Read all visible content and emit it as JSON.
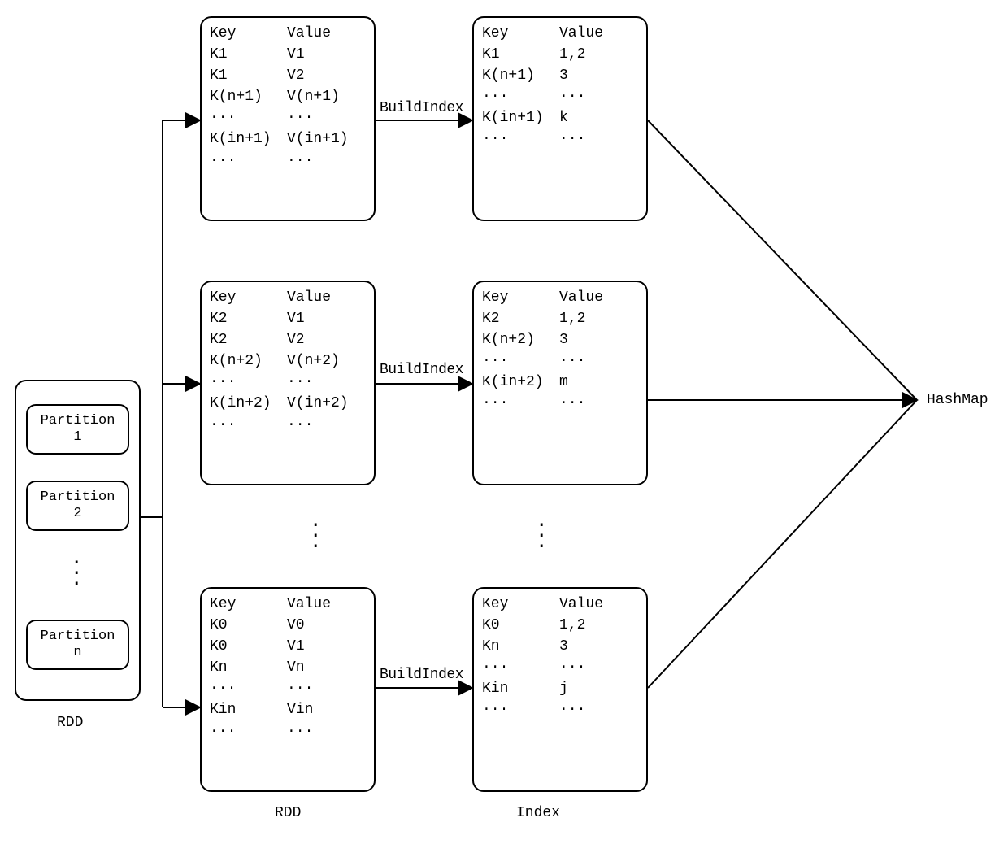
{
  "rdd": {
    "label": "RDD",
    "partitions": [
      {
        "line1": "Partition",
        "line2": "1"
      },
      {
        "line1": "Partition",
        "line2": "2"
      },
      {
        "line1": "Partition",
        "line2": "n"
      }
    ]
  },
  "kv_tables": [
    {
      "header": {
        "k": "Key",
        "v": "Value"
      },
      "rows": [
        {
          "k": "K1",
          "v": "V1"
        },
        {
          "k": "K1",
          "v": "V2"
        },
        {
          "k": "K(n+1)",
          "v": "V(n+1)"
        },
        {
          "k": "···",
          "v": "···"
        },
        {
          "k": "K(in+1)",
          "v": "V(in+1)"
        },
        {
          "k": "···",
          "v": "···"
        }
      ]
    },
    {
      "header": {
        "k": "Key",
        "v": "Value"
      },
      "rows": [
        {
          "k": "K2",
          "v": "V1"
        },
        {
          "k": "K2",
          "v": "V2"
        },
        {
          "k": "K(n+2)",
          "v": "V(n+2)"
        },
        {
          "k": "···",
          "v": "···"
        },
        {
          "k": "K(in+2)",
          "v": "V(in+2)"
        },
        {
          "k": "···",
          "v": "···"
        }
      ]
    },
    {
      "header": {
        "k": "Key",
        "v": "Value"
      },
      "rows": [
        {
          "k": "K0",
          "v": "V0"
        },
        {
          "k": "K0",
          "v": "V1"
        },
        {
          "k": "Kn",
          "v": "Vn"
        },
        {
          "k": "···",
          "v": "···"
        },
        {
          "k": "Kin",
          "v": "Vin"
        },
        {
          "k": "···",
          "v": "···"
        }
      ]
    }
  ],
  "index_tables": [
    {
      "header": {
        "k": "Key",
        "v": "Value"
      },
      "rows": [
        {
          "k": "K1",
          "v": "1,2"
        },
        {
          "k": "K(n+1)",
          "v": "3"
        },
        {
          "k": "···",
          "v": "···"
        },
        {
          "k": "K(in+1)",
          "v": "k"
        },
        {
          "k": "···",
          "v": "···"
        }
      ]
    },
    {
      "header": {
        "k": "Key",
        "v": "Value"
      },
      "rows": [
        {
          "k": "K2",
          "v": "1,2"
        },
        {
          "k": "K(n+2)",
          "v": "3"
        },
        {
          "k": "···",
          "v": "···"
        },
        {
          "k": "K(in+2)",
          "v": "m"
        },
        {
          "k": "···",
          "v": "···"
        }
      ]
    },
    {
      "header": {
        "k": "Key",
        "v": "Value"
      },
      "rows": [
        {
          "k": "K0",
          "v": "1,2"
        },
        {
          "k": "Kn",
          "v": "3"
        },
        {
          "k": "···",
          "v": "···"
        },
        {
          "k": "Kin",
          "v": "j"
        },
        {
          "k": "···",
          "v": "···"
        }
      ]
    }
  ],
  "arrows": {
    "buildindex": "BuildIndex"
  },
  "bottom": {
    "rdd": "RDD",
    "index": "Index"
  },
  "result": "HashMap"
}
